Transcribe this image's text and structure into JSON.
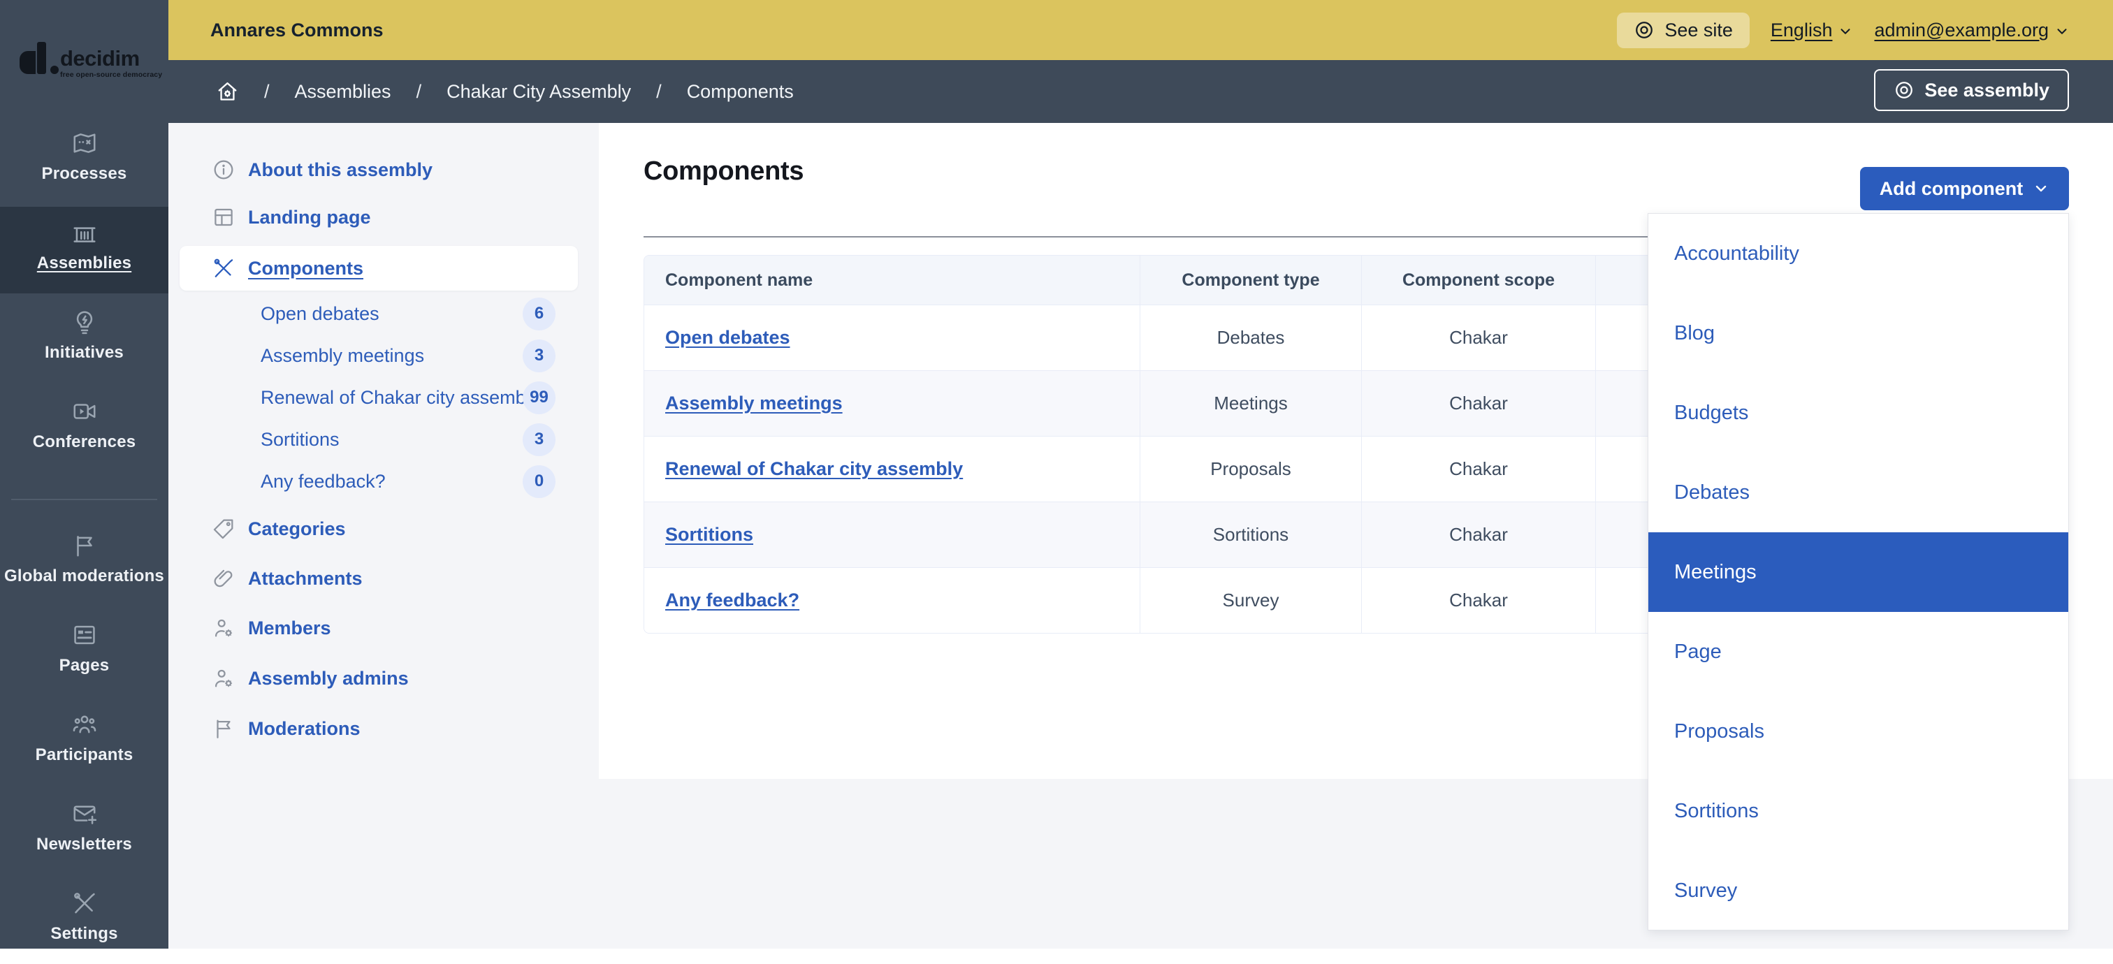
{
  "colors": {
    "accent_yellow": "#dbc45e",
    "sidebar_dark": "#3e4a59",
    "sidebar_active_dark": "#2b3643",
    "primary_blue": "#2b5cbd",
    "link_blue": "#2d5cb9",
    "page_background": "#f4f5f8",
    "badge_background": "#e3eafb",
    "table_border": "#e8ecf7"
  },
  "brand": {
    "name": "decidim",
    "tagline": "free open-source democracy"
  },
  "topbar": {
    "title": "Annares Commons",
    "see_site_label": "See site",
    "language": "English",
    "user_email": "admin@example.org"
  },
  "breadcrumb": {
    "separator": "/",
    "items": [
      "Assemblies",
      "Chakar City Assembly",
      "Components"
    ],
    "see_assembly_label": "See assembly"
  },
  "sidebar": {
    "items": [
      {
        "label": "Processes",
        "icon": "map-icon",
        "active": false
      },
      {
        "label": "Assemblies",
        "icon": "government-building-icon",
        "active": true
      },
      {
        "label": "Initiatives",
        "icon": "lightbulb-flash-icon",
        "active": false
      },
      {
        "label": "Conferences",
        "icon": "video-camera-icon",
        "active": false
      },
      {
        "label": "Global moderations",
        "icon": "flag-icon",
        "active": false
      },
      {
        "label": "Pages",
        "icon": "page-layout-icon",
        "active": false
      },
      {
        "label": "Participants",
        "icon": "group-icon",
        "active": false
      },
      {
        "label": "Newsletters",
        "icon": "mail-add-icon",
        "active": false
      },
      {
        "label": "Settings",
        "icon": "tools-icon",
        "active": false
      }
    ]
  },
  "secondary_nav": {
    "items": [
      {
        "label": "About this assembly",
        "icon": "info-circle-icon",
        "active": false
      },
      {
        "label": "Landing page",
        "icon": "layout-grid-icon",
        "active": false
      },
      {
        "label": "Components",
        "icon": "tools-icon",
        "active": true,
        "children": [
          {
            "label": "Open debates",
            "count": "6"
          },
          {
            "label": "Assembly meetings",
            "count": "3"
          },
          {
            "label": "Renewal of Chakar city assembly",
            "count": "99"
          },
          {
            "label": "Sortitions",
            "count": "3"
          },
          {
            "label": "Any feedback?",
            "count": "0"
          }
        ]
      },
      {
        "label": "Categories",
        "icon": "price-tag-icon",
        "active": false
      },
      {
        "label": "Attachments",
        "icon": "paperclip-icon",
        "active": false
      },
      {
        "label": "Members",
        "icon": "user-settings-icon",
        "active": false
      },
      {
        "label": "Assembly admins",
        "icon": "user-settings-icon",
        "active": false
      },
      {
        "label": "Moderations",
        "icon": "flag-icon",
        "active": false
      }
    ]
  },
  "main": {
    "title": "Components",
    "add_component_label": "Add component",
    "table": {
      "columns": [
        "Component name",
        "Component type",
        "Component scope"
      ],
      "rows": [
        {
          "name": "Open debates",
          "type": "Debates",
          "scope": "Chakar"
        },
        {
          "name": "Assembly meetings",
          "type": "Meetings",
          "scope": "Chakar"
        },
        {
          "name": "Renewal of Chakar city assembly",
          "type": "Proposals",
          "scope": "Chakar"
        },
        {
          "name": "Sortitions",
          "type": "Sortitions",
          "scope": "Chakar"
        },
        {
          "name": "Any feedback?",
          "type": "Survey",
          "scope": "Chakar"
        }
      ]
    },
    "dropdown": {
      "items": [
        "Accountability",
        "Blog",
        "Budgets",
        "Debates",
        "Meetings",
        "Page",
        "Proposals",
        "Sortitions",
        "Survey"
      ],
      "selected": "Meetings"
    }
  }
}
